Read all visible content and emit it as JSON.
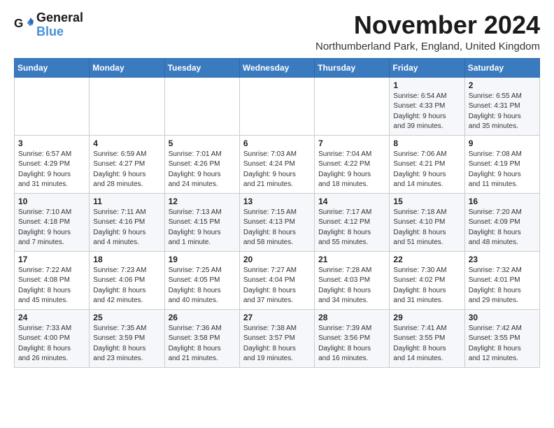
{
  "logo": {
    "line1": "General",
    "line2": "Blue"
  },
  "title": "November 2024",
  "location": "Northumberland Park, England, United Kingdom",
  "days_of_week": [
    "Sunday",
    "Monday",
    "Tuesday",
    "Wednesday",
    "Thursday",
    "Friday",
    "Saturday"
  ],
  "weeks": [
    [
      {
        "day": "",
        "info": ""
      },
      {
        "day": "",
        "info": ""
      },
      {
        "day": "",
        "info": ""
      },
      {
        "day": "",
        "info": ""
      },
      {
        "day": "",
        "info": ""
      },
      {
        "day": "1",
        "info": "Sunrise: 6:54 AM\nSunset: 4:33 PM\nDaylight: 9 hours\nand 39 minutes."
      },
      {
        "day": "2",
        "info": "Sunrise: 6:55 AM\nSunset: 4:31 PM\nDaylight: 9 hours\nand 35 minutes."
      }
    ],
    [
      {
        "day": "3",
        "info": "Sunrise: 6:57 AM\nSunset: 4:29 PM\nDaylight: 9 hours\nand 31 minutes."
      },
      {
        "day": "4",
        "info": "Sunrise: 6:59 AM\nSunset: 4:27 PM\nDaylight: 9 hours\nand 28 minutes."
      },
      {
        "day": "5",
        "info": "Sunrise: 7:01 AM\nSunset: 4:26 PM\nDaylight: 9 hours\nand 24 minutes."
      },
      {
        "day": "6",
        "info": "Sunrise: 7:03 AM\nSunset: 4:24 PM\nDaylight: 9 hours\nand 21 minutes."
      },
      {
        "day": "7",
        "info": "Sunrise: 7:04 AM\nSunset: 4:22 PM\nDaylight: 9 hours\nand 18 minutes."
      },
      {
        "day": "8",
        "info": "Sunrise: 7:06 AM\nSunset: 4:21 PM\nDaylight: 9 hours\nand 14 minutes."
      },
      {
        "day": "9",
        "info": "Sunrise: 7:08 AM\nSunset: 4:19 PM\nDaylight: 9 hours\nand 11 minutes."
      }
    ],
    [
      {
        "day": "10",
        "info": "Sunrise: 7:10 AM\nSunset: 4:18 PM\nDaylight: 9 hours\nand 7 minutes."
      },
      {
        "day": "11",
        "info": "Sunrise: 7:11 AM\nSunset: 4:16 PM\nDaylight: 9 hours\nand 4 minutes."
      },
      {
        "day": "12",
        "info": "Sunrise: 7:13 AM\nSunset: 4:15 PM\nDaylight: 9 hours\nand 1 minute."
      },
      {
        "day": "13",
        "info": "Sunrise: 7:15 AM\nSunset: 4:13 PM\nDaylight: 8 hours\nand 58 minutes."
      },
      {
        "day": "14",
        "info": "Sunrise: 7:17 AM\nSunset: 4:12 PM\nDaylight: 8 hours\nand 55 minutes."
      },
      {
        "day": "15",
        "info": "Sunrise: 7:18 AM\nSunset: 4:10 PM\nDaylight: 8 hours\nand 51 minutes."
      },
      {
        "day": "16",
        "info": "Sunrise: 7:20 AM\nSunset: 4:09 PM\nDaylight: 8 hours\nand 48 minutes."
      }
    ],
    [
      {
        "day": "17",
        "info": "Sunrise: 7:22 AM\nSunset: 4:08 PM\nDaylight: 8 hours\nand 45 minutes."
      },
      {
        "day": "18",
        "info": "Sunrise: 7:23 AM\nSunset: 4:06 PM\nDaylight: 8 hours\nand 42 minutes."
      },
      {
        "day": "19",
        "info": "Sunrise: 7:25 AM\nSunset: 4:05 PM\nDaylight: 8 hours\nand 40 minutes."
      },
      {
        "day": "20",
        "info": "Sunrise: 7:27 AM\nSunset: 4:04 PM\nDaylight: 8 hours\nand 37 minutes."
      },
      {
        "day": "21",
        "info": "Sunrise: 7:28 AM\nSunset: 4:03 PM\nDaylight: 8 hours\nand 34 minutes."
      },
      {
        "day": "22",
        "info": "Sunrise: 7:30 AM\nSunset: 4:02 PM\nDaylight: 8 hours\nand 31 minutes."
      },
      {
        "day": "23",
        "info": "Sunrise: 7:32 AM\nSunset: 4:01 PM\nDaylight: 8 hours\nand 29 minutes."
      }
    ],
    [
      {
        "day": "24",
        "info": "Sunrise: 7:33 AM\nSunset: 4:00 PM\nDaylight: 8 hours\nand 26 minutes."
      },
      {
        "day": "25",
        "info": "Sunrise: 7:35 AM\nSunset: 3:59 PM\nDaylight: 8 hours\nand 23 minutes."
      },
      {
        "day": "26",
        "info": "Sunrise: 7:36 AM\nSunset: 3:58 PM\nDaylight: 8 hours\nand 21 minutes."
      },
      {
        "day": "27",
        "info": "Sunrise: 7:38 AM\nSunset: 3:57 PM\nDaylight: 8 hours\nand 19 minutes."
      },
      {
        "day": "28",
        "info": "Sunrise: 7:39 AM\nSunset: 3:56 PM\nDaylight: 8 hours\nand 16 minutes."
      },
      {
        "day": "29",
        "info": "Sunrise: 7:41 AM\nSunset: 3:55 PM\nDaylight: 8 hours\nand 14 minutes."
      },
      {
        "day": "30",
        "info": "Sunrise: 7:42 AM\nSunset: 3:55 PM\nDaylight: 8 hours\nand 12 minutes."
      }
    ]
  ]
}
